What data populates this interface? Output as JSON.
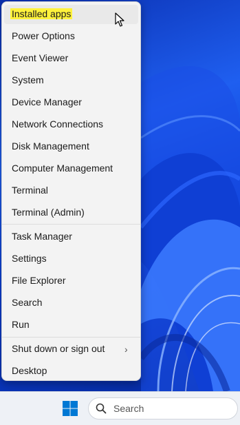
{
  "menu": {
    "items": [
      {
        "label": "Installed apps",
        "highlighted": true
      },
      {
        "label": "Power Options"
      },
      {
        "label": "Event Viewer"
      },
      {
        "label": "System"
      },
      {
        "label": "Device Manager"
      },
      {
        "label": "Network Connections"
      },
      {
        "label": "Disk Management"
      },
      {
        "label": "Computer Management"
      },
      {
        "label": "Terminal"
      },
      {
        "label": "Terminal (Admin)"
      },
      {
        "label": "Task Manager"
      },
      {
        "label": "Settings"
      },
      {
        "label": "File Explorer"
      },
      {
        "label": "Search"
      },
      {
        "label": "Run"
      },
      {
        "label": "Shut down or sign out",
        "has_submenu": true
      },
      {
        "label": "Desktop"
      }
    ],
    "highlight_color": "#fff23c"
  },
  "taskbar": {
    "search_placeholder": "Search",
    "start_icon": "windows-logo-icon",
    "search_icon": "search-icon",
    "accent": "#0078d4"
  },
  "desktop": {
    "wallpaper": "blue-bloom",
    "accent": "#1f5ff0"
  }
}
